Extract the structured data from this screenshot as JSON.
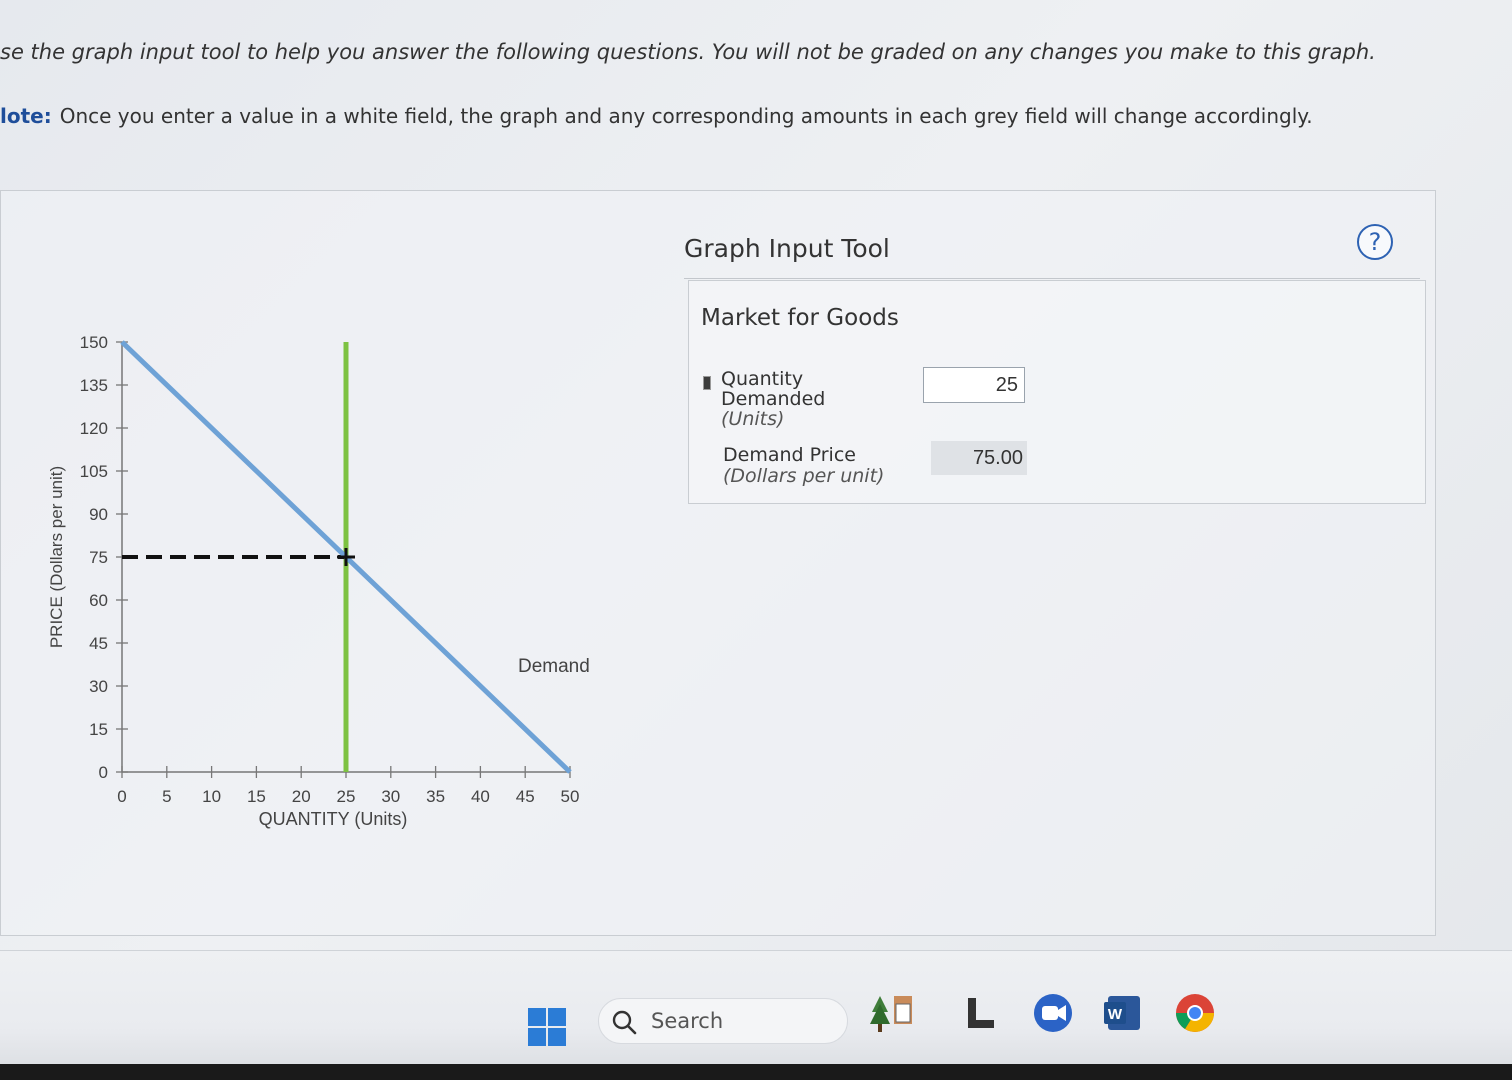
{
  "intro_text": "se the graph input tool to help you answer the following questions. You will not be graded on any changes you make to this graph.",
  "note": {
    "label": "lote:",
    "text": "Once you enter a value in a white field, the graph and any corresponding amounts in each grey field will change accordingly."
  },
  "tool": {
    "title": "Graph Input Tool",
    "help_symbol": "?",
    "market_title": "Market for Goods",
    "quantity_label_1": "Quantity",
    "quantity_label_2": "Demanded",
    "quantity_unit": "(Units)",
    "quantity_value": "25",
    "price_label": "Demand Price",
    "price_unit": "(Dollars per unit)",
    "price_value": "75.00"
  },
  "chart_data": {
    "type": "line",
    "xlabel": "QUANTITY (Units)",
    "ylabel": "PRICE (Dollars per unit)",
    "xlim": [
      0,
      50
    ],
    "ylim": [
      0,
      150
    ],
    "x_ticks": [
      0,
      5,
      10,
      15,
      20,
      25,
      30,
      35,
      40,
      45,
      50
    ],
    "y_ticks": [
      0,
      15,
      30,
      45,
      60,
      75,
      90,
      105,
      120,
      135,
      150
    ],
    "series": [
      {
        "name": "Demand",
        "points": [
          [
            0,
            150
          ],
          [
            50,
            0
          ]
        ],
        "color": "#6ea2d6"
      }
    ],
    "quantity_line": {
      "x": 25,
      "color": "#7dc242"
    },
    "selected_point": {
      "x": 25,
      "y": 75
    },
    "price_guide": {
      "y": 75,
      "style": "dashed",
      "color": "#111111"
    }
  },
  "taskbar": {
    "search_placeholder": "Search",
    "accent_color": "#2b7cd6"
  }
}
